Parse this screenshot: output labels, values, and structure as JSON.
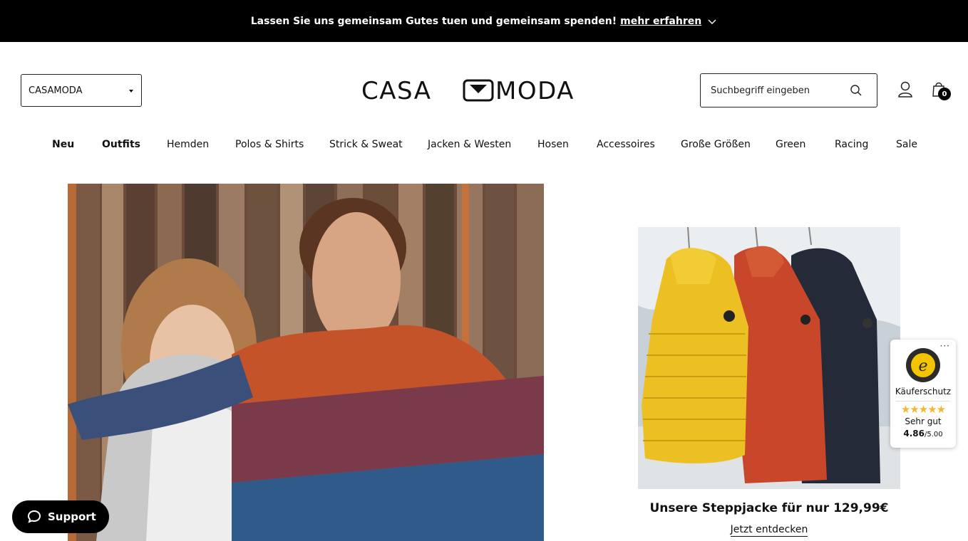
{
  "topbar": {
    "message": "Lassen Sie uns gemeinsam Gutes tuen und gemeinsam spenden!",
    "link": "mehr erfahren"
  },
  "header": {
    "store_select": "CASAMODA",
    "logo_text": "CASA MODA",
    "search_placeholder": "Suchbegriff eingeben",
    "cart_count": "0"
  },
  "nav": {
    "items": [
      {
        "label": "Neu"
      },
      {
        "label": "Outfits"
      },
      {
        "label": "Hemden"
      },
      {
        "label": "Polos & Shirts"
      },
      {
        "label": "Strick & Sweat"
      },
      {
        "label": "Jacken & Westen"
      },
      {
        "label": "Hosen"
      },
      {
        "label": "Accessoires"
      },
      {
        "label": "Große Größen"
      },
      {
        "label": "Green"
      },
      {
        "label": "Racing"
      },
      {
        "label": "Sale"
      }
    ]
  },
  "promo": {
    "title": "Unsere Steppjacke für nur 129,99€",
    "link": "Jetzt entdecken"
  },
  "trust": {
    "label": "Käuferschutz",
    "rating_text": "Sehr gut",
    "score": "4.86",
    "max": "/5.00",
    "stars": "★★★★★"
  },
  "support": {
    "label": "Support"
  }
}
